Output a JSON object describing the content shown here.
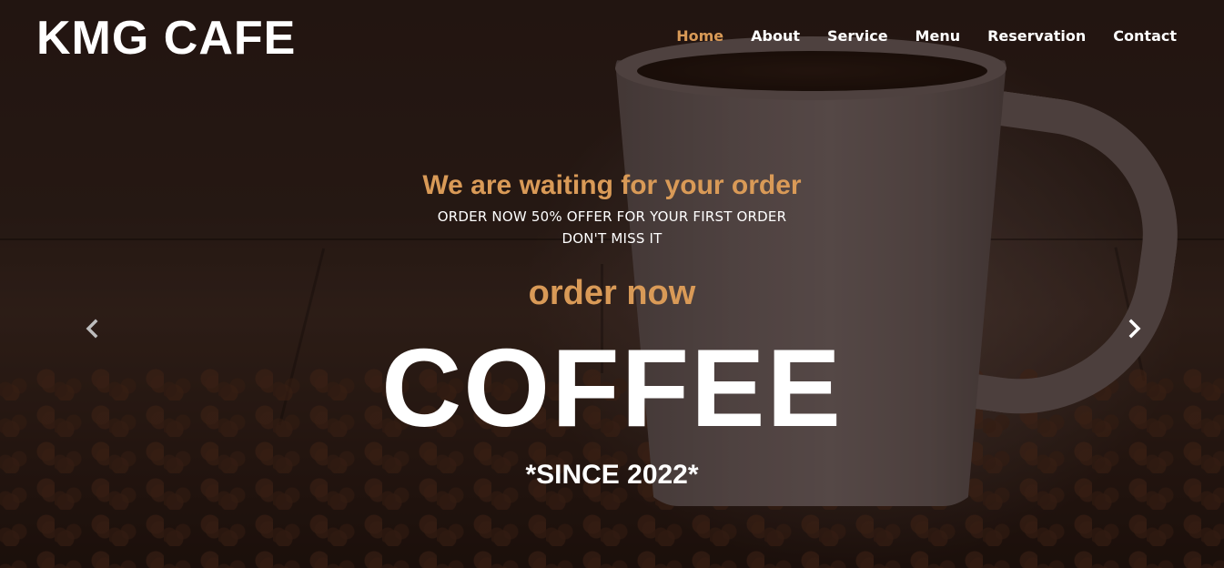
{
  "header": {
    "logo": "KMG CAFE",
    "nav": [
      {
        "label": "Home",
        "active": true
      },
      {
        "label": "About",
        "active": false
      },
      {
        "label": "Service",
        "active": false
      },
      {
        "label": "Menu",
        "active": false
      },
      {
        "label": "Reservation",
        "active": false
      },
      {
        "label": "Contact",
        "active": false
      }
    ]
  },
  "hero": {
    "subheading": "We are waiting for your order",
    "promo_line1": "ORDER NOW 50% OFFER FOR YOUR FIRST ORDER",
    "promo_line2": "DON'T MISS IT",
    "order_link": "order now",
    "headline": "COFFEE",
    "since": "*SINCE 2022*"
  },
  "carousel": {
    "prev_icon": "chevron-left-icon",
    "next_icon": "chevron-right-icon"
  },
  "colors": {
    "accent": "#d99a57",
    "text": "#ffffff"
  }
}
